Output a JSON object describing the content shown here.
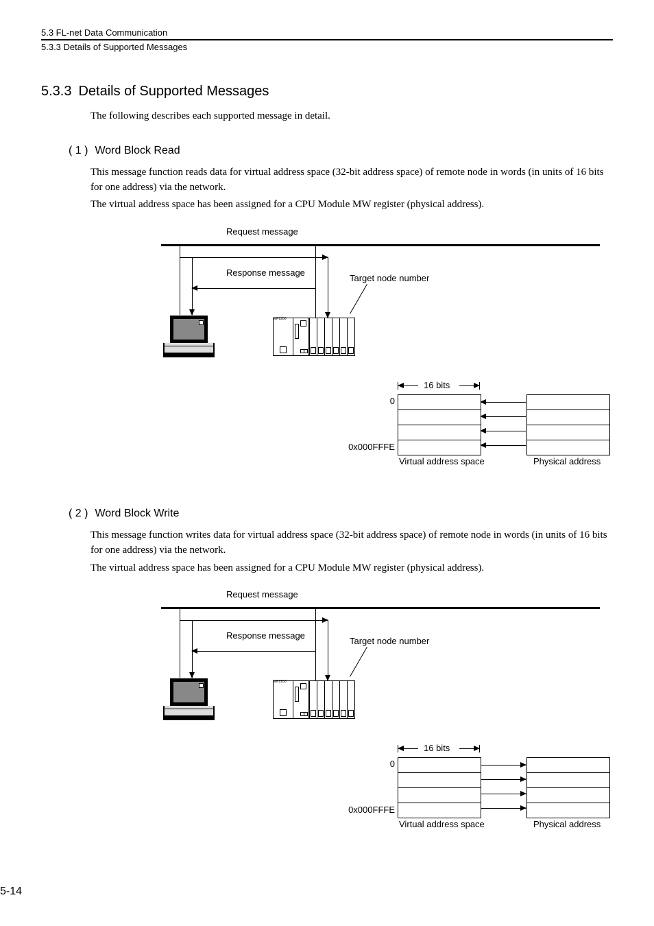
{
  "header": {
    "chapter": "5.3  FL-net Data Communication",
    "subsection": "5.3.3  Details of Supported Messages"
  },
  "section": {
    "number": "5.3.3",
    "title": "Details of Supported Messages",
    "intro": "The following describes each supported message in detail."
  },
  "sub1": {
    "num": "( 1 )",
    "title": "Word Block Read",
    "p1": "This message function reads data for virtual address space (32-bit address space) of remote node in words (in units of 16 bits for one address) via the network.",
    "p2": "The virtual address space has been assigned for a CPU Module MW register (physical address)."
  },
  "sub2": {
    "num": "( 2 )",
    "title": "Word Block Write",
    "p1": "This message function writes data for virtual address space (32-bit address space) of remote node in words (in units of 16 bits for one address) via the network.",
    "p2": "The virtual address space has been assigned for a CPU Module MW register (physical address)."
  },
  "figure": {
    "request_msg": "Request message",
    "response_msg": "Response message",
    "target_node": "Target node number",
    "controller_label": "MP2200",
    "bits16": "16 bits",
    "addr0": "0",
    "addr_end": "0x000FFFE",
    "va_label": "Virtual address space",
    "pa_label": "Physical address"
  },
  "page": "5-14"
}
